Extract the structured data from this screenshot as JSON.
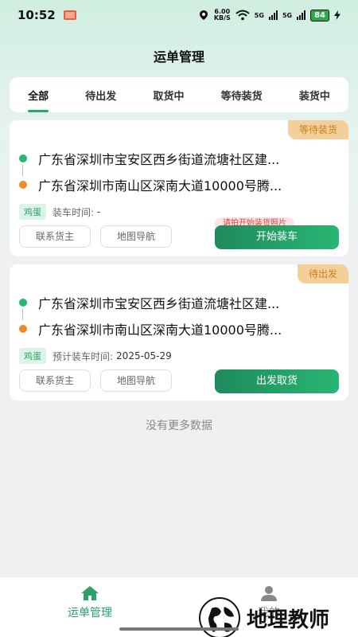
{
  "status_bar": {
    "time": "10:52",
    "speed_value": "6.00",
    "speed_unit": "KB/S",
    "battery": "84",
    "net1": "5G",
    "net2": "5G"
  },
  "header": {
    "title": "运单管理"
  },
  "tabs": [
    {
      "label": "全部",
      "active": true
    },
    {
      "label": "待出发",
      "active": false
    },
    {
      "label": "取货中",
      "active": false
    },
    {
      "label": "等待装货",
      "active": false
    },
    {
      "label": "装货中",
      "active": false
    }
  ],
  "orders": [
    {
      "status": "等待装货",
      "from": "广东省深圳市宝安区西乡街道流塘社区建...",
      "to": "广东省深圳市南山区深南大道10000号腾...",
      "goods": "鸡蛋",
      "time_label": "装车时间:",
      "time_value": "-",
      "contact_btn": "联系货主",
      "nav_btn": "地图导航",
      "primary_btn": "开始装车",
      "hint": "请拍开始装货照片"
    },
    {
      "status": "待出发",
      "from": "广东省深圳市宝安区西乡街道流塘社区建...",
      "to": "广东省深圳市南山区深南大道10000号腾...",
      "goods": "鸡蛋",
      "time_label": "预计装车时间:",
      "time_value": "2025-05-29",
      "contact_btn": "联系货主",
      "nav_btn": "地图导航",
      "primary_btn": "出发取货"
    }
  ],
  "list_footer": "没有更多数据",
  "tabbar": [
    {
      "label": "运单管理",
      "icon": "home-icon",
      "active": true
    },
    {
      "label": "我的",
      "icon": "person-icon",
      "active": false
    }
  ],
  "watermark": {
    "text": "地理教师"
  },
  "colors": {
    "accent": "#2aa26a",
    "badge_bg": "#f5cf9a",
    "badge_text": "#c7801d",
    "hint_bg": "#fde3e3",
    "hint_text": "#e0443b"
  }
}
